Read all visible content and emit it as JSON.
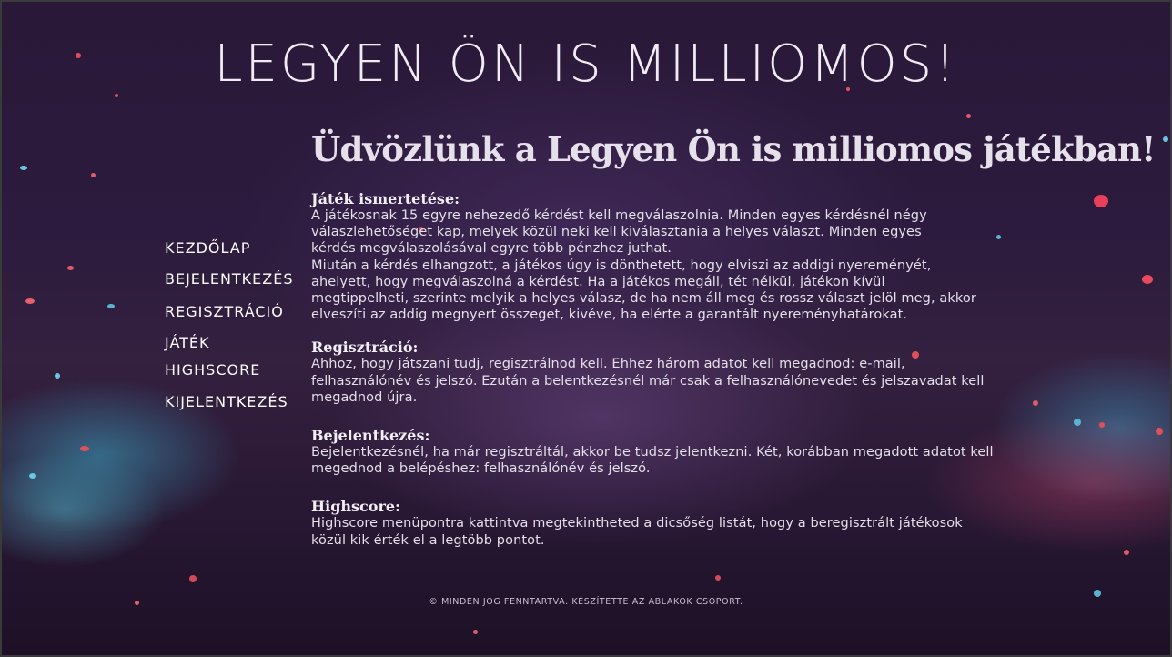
{
  "site": {
    "title": "LEGYEN ÖN IS MILLIOMOS!"
  },
  "nav": {
    "items": [
      {
        "label": "Kezdőlap"
      },
      {
        "label": "Bejelentkezés"
      },
      {
        "label": "Regisztráció"
      },
      {
        "label": "Játék"
      },
      {
        "label": "Highscore"
      },
      {
        "label": "Kijelentkezés"
      }
    ]
  },
  "main": {
    "welcome": "Üdvözlünk a Legyen Ön is milliomos játékban!",
    "sections": [
      {
        "heading": "Játék ismertetése:",
        "paragraphs": [
          "A játékosnak 15 egyre nehezedő kérdést kell megválaszolnia. Minden egyes kérdésnél négy válaszlehetőséget kap, melyek közül neki kell kiválasztania a helyes választ. Minden egyes kérdés megválaszolásával egyre több pénzhez juthat.",
          "Miután a kérdés elhangzott, a játékos úgy is dönthetett, hogy elviszi az addigi nyereményét, ahelyett, hogy megválaszolná a kérdést. Ha a játékos megáll, tét nélkül, játékon kívül megtippelheti, szerinte melyik a helyes válasz, de ha nem áll meg és rossz választ jelöl meg, akkor elveszíti az addig megnyert összeget, kivéve, ha elérte a garantált nyereményhatárokat."
        ]
      },
      {
        "heading": "Regisztráció:",
        "paragraphs": [
          "Ahhoz, hogy játszani tudj, regisztrálnod kell. Ehhez három adatot kell megadnod: e-mail, felhasználónév és jelszó. Ezután a belentkezésnél már csak a felhasználónevedet és jelszavadat kell megadnod újra."
        ]
      },
      {
        "heading": "Bejelentkezés:",
        "paragraphs": [
          "Bejelentkezésnél, ha már regisztráltál, akkor be tudsz jelentkezni. Két, korábban megadott adatot kell megednod a belépéshez: felhasználónév és jelszó."
        ]
      },
      {
        "heading": "Highscore:",
        "paragraphs": [
          "Highscore menüpontra kattintva megtekintheted a dicsőség listát, hogy a beregisztrált játékosok közül kik érték el a legtöbb pontot."
        ]
      }
    ]
  },
  "footer": {
    "text": "© Minden jog fenntartva. Készítette az Ablakok csoport."
  },
  "colors": {
    "background": "#2c1b3e",
    "text": "#e8e4ec",
    "accent_cyan": "#5ab4d0",
    "accent_red": "#e0505a"
  }
}
